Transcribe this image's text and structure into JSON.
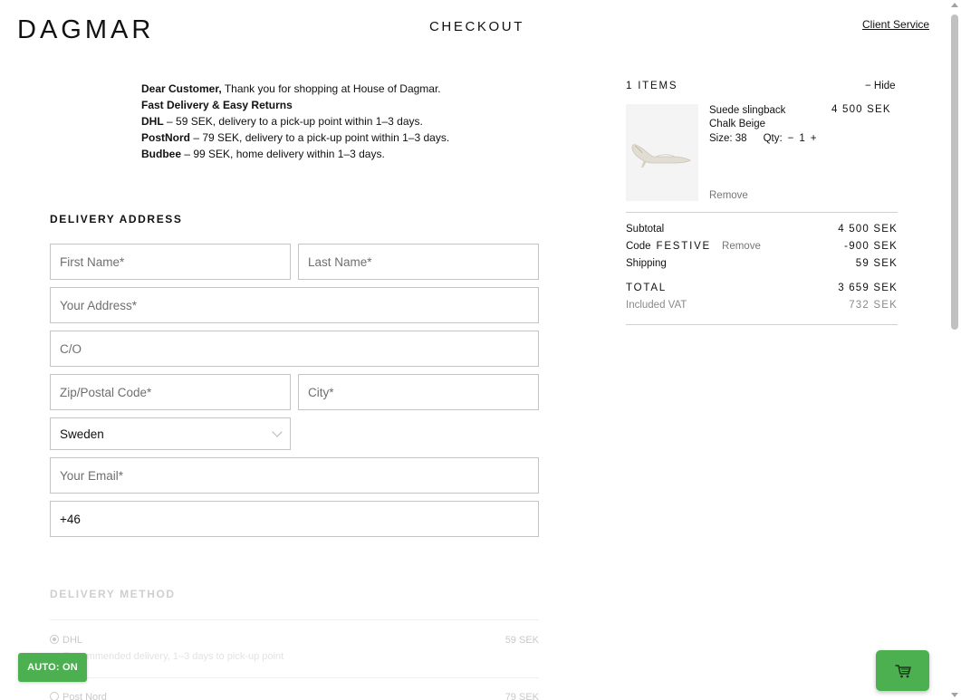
{
  "header": {
    "logo": "DAGMAR",
    "title": "CHECKOUT",
    "client_service": "Client Service"
  },
  "info": {
    "greeting_bold": "Dear Customer,",
    "greeting_rest": " Thank you for shopping at House of Dagmar.",
    "fast_delivery": "Fast Delivery & Easy Returns",
    "carriers": [
      {
        "name": "DHL",
        "text": " – 59 SEK, delivery to a pick-up point within 1–3 days."
      },
      {
        "name": "PostNord",
        "text": " – 79 SEK, delivery to a pick-up point within 1–3 days."
      },
      {
        "name": "Budbee",
        "text": " – 99 SEK, home delivery within 1–3 days."
      }
    ]
  },
  "delivery_address": {
    "title": "DELIVERY ADDRESS",
    "first_name_placeholder": "First Name*",
    "last_name_placeholder": "Last Name*",
    "address_placeholder": "Your Address*",
    "co_placeholder": "C/O",
    "zip_placeholder": "Zip/Postal Code*",
    "city_placeholder": "City*",
    "country": "Sweden",
    "email_placeholder": "Your Email*",
    "phone_value": "+46"
  },
  "delivery_method": {
    "title": "DELIVERY METHOD",
    "options": [
      {
        "name": "DHL",
        "price": "59 SEK",
        "sub": "Recommended delivery, 1–3 days to pick-up point"
      },
      {
        "name": "Post Nord",
        "price": "79 SEK"
      }
    ]
  },
  "summary": {
    "items_label": "1 ITEMS",
    "hide_label": "− Hide",
    "product": {
      "name": "Suede slingback",
      "color": "Chalk Beige",
      "size_label": "Size: 38",
      "qty_label": "Qty:",
      "qty_minus": "−",
      "qty": "1",
      "qty_plus": "+",
      "price": "4 500 SEK",
      "remove": "Remove"
    },
    "subtotal_label": "Subtotal",
    "subtotal": "4 500 SEK",
    "code_label": "Code",
    "code_name": "FESTIVE",
    "code_remove": "Remove",
    "code_value": "-900 SEK",
    "shipping_label": "Shipping",
    "shipping": "59 SEK",
    "total_label": "TOTAL",
    "total": "3 659 SEK",
    "vat_label": "Included VAT",
    "vat": "732 SEK"
  },
  "widgets": {
    "auto_label": "AUTO: ON"
  },
  "colors": {
    "accent_green": "#4caf50",
    "border": "#c4c4c4"
  }
}
